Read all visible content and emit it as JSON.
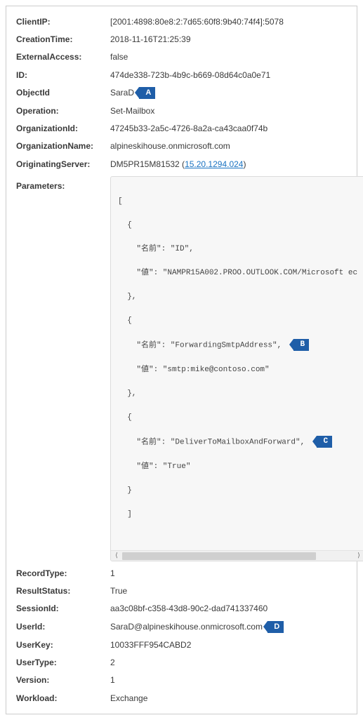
{
  "fields": {
    "clientIP": {
      "label": "ClientIP:",
      "value": "[2001:4898:80e8:2:7d65:60f8:9b40:74f4]:5078"
    },
    "creationTime": {
      "label": "CreationTime:",
      "value": "2018-11-16T21:25:39"
    },
    "externalAccess": {
      "label": "ExternalAccess:",
      "value": "false"
    },
    "id": {
      "label": "ID:",
      "value": "474de338-723b-4b9c-b669-08d64c0a0e71"
    },
    "objectId": {
      "label": "ObjectId",
      "value": "SaraD",
      "callout": "A"
    },
    "operation": {
      "label": "Operation:",
      "value": "Set-Mailbox"
    },
    "organizationId": {
      "label": "OrganizationId:",
      "value": "47245b33-2a5c-4726-8a2a-ca43caa0f74b"
    },
    "organizationName": {
      "label": "OrganizationName:",
      "value": "alpineskihouse.onmicrosoft.com"
    },
    "originatingServer": {
      "label": "OriginatingServer:",
      "prefix": "DM5PR15M81532 (",
      "linkText": "15.20.1294.024",
      "suffix": ")"
    },
    "parameters": {
      "label": "Parameters:"
    },
    "recordType": {
      "label": "RecordType:",
      "value": "1"
    },
    "resultStatus": {
      "label": "ResultStatus:",
      "value": "True"
    },
    "sessionId": {
      "label": "SessionId:",
      "value": "aa3c08bf-c358-43d8-90c2-dad741337460"
    },
    "userId": {
      "label": "UserId:",
      "value": "SaraD@alpineskihouse.onmicrosoft.com",
      "callout": "D"
    },
    "userKey": {
      "label": "UserKey:",
      "value": "10033FFF954CABD2"
    },
    "userType": {
      "label": "UserType:",
      "value": "2"
    },
    "version": {
      "label": "Version:",
      "value": "1"
    },
    "workload": {
      "label": "Workload:",
      "value": "Exchange"
    }
  },
  "param_lines": {
    "l0": "[",
    "l1": "  {",
    "l2": "    \"名前\": \"ID\",",
    "l3": "    \"値\": \"NAMPR15A002.PROO.OUTLOOK.COM/Microsoft ec",
    "l4": "  },",
    "l5": "  {",
    "l6a": "    \"名前\": \"ForwardingSmtpAddress\",",
    "l7": "    \"値\": \"smtp:mike@contoso.com\"",
    "l8": "  },",
    "l9": "  {",
    "l10a": "    \"名前\": \"DeliverToMailboxAndForward\",",
    "l11": "    \"値\": \"True\"",
    "l12": "  }",
    "l13": "  ]"
  },
  "callouts": {
    "b": "B",
    "c": "C"
  },
  "scroll_arrows": {
    "left": "⟨",
    "right": "⟩"
  }
}
